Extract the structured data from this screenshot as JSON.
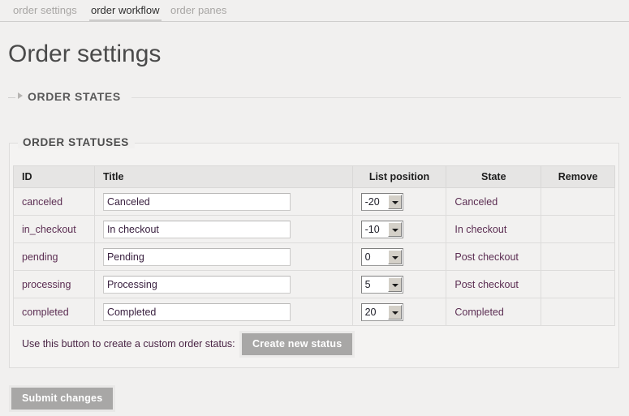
{
  "tabs": [
    {
      "label": "order settings",
      "active": false
    },
    {
      "label": "order workflow",
      "active": true
    },
    {
      "label": "order panes",
      "active": false
    }
  ],
  "page": {
    "title": "Order settings"
  },
  "section": {
    "label": "ORDER STATES",
    "collapsed": true,
    "toggle_icon": "triangle-right-icon"
  },
  "fieldset": {
    "legend": "ORDER STATUSES"
  },
  "table": {
    "columns": [
      "ID",
      "Title",
      "List position",
      "State",
      "Remove"
    ],
    "rows": [
      {
        "id": "canceled",
        "title": "Canceled",
        "position": "-20",
        "state": "Canceled",
        "remove": ""
      },
      {
        "id": "in_checkout",
        "title": "In checkout",
        "position": "-10",
        "state": "In checkout",
        "remove": ""
      },
      {
        "id": "pending",
        "title": "Pending",
        "position": "0",
        "state": "Post checkout",
        "remove": ""
      },
      {
        "id": "processing",
        "title": "Processing",
        "position": "5",
        "state": "Post checkout",
        "remove": ""
      },
      {
        "id": "completed",
        "title": "Completed",
        "position": "20",
        "state": "Completed",
        "remove": ""
      }
    ],
    "position_options": [
      "-20",
      "-10",
      "0",
      "5",
      "20"
    ]
  },
  "create": {
    "label": "Use this button to create a custom order status:",
    "button_label": "Create new status"
  },
  "submit": {
    "button_label": "Submit changes"
  },
  "colors": {
    "page_bg": "#f1f0ef",
    "text_primary": "#4a4a4a",
    "text_link_purple": "#5b2d52",
    "button_gray": "#a8a7a6",
    "header_row": "#e6e5e4",
    "border": "#dedddc"
  }
}
